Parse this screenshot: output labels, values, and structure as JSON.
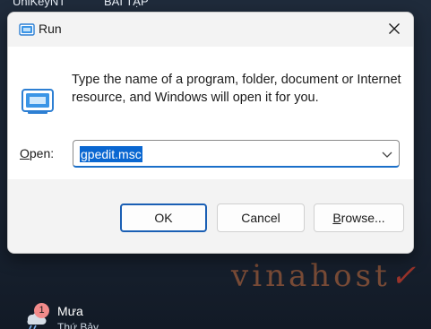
{
  "desktop": {
    "top_label_1": "UniKeyNT",
    "top_label_2": "BÀI TẬP",
    "watermark": "vinahost",
    "weather": {
      "badge": "1",
      "title": "Mưa",
      "subtitle": "Thứ Bảy",
      "icon": "rain-cloud-icon"
    }
  },
  "dialog": {
    "title": "Run",
    "title_icon": "run-icon",
    "description": "Type the name of a program, folder, document or Internet resource, and Windows will open it for you.",
    "open_label_accel": "O",
    "open_label_rest": "pen:",
    "open_value": "gpedit.msc",
    "buttons": {
      "ok": "OK",
      "cancel": "Cancel",
      "browse_accel": "B",
      "browse_rest": "rowse..."
    },
    "colors": {
      "accent": "#0a67d1",
      "dialog_bg": "#f3f3f3",
      "content_bg": "#ffffff"
    }
  }
}
